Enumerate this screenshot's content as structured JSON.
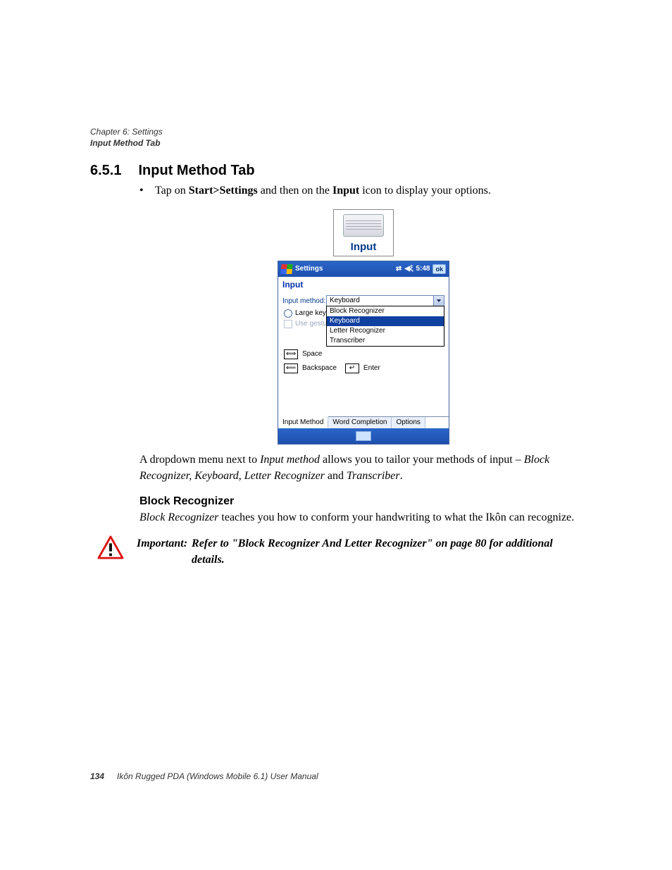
{
  "running_head": {
    "chapter": "Chapter 6:  Settings",
    "section": "Input Method Tab"
  },
  "section": {
    "number": "6.5.1",
    "title": "Input Method Tab"
  },
  "bullet": {
    "pre": "Tap on ",
    "b1": "Start>Settings",
    "mid": " and then on the ",
    "b2": "Input",
    "post": " icon to display your options."
  },
  "icon_label": "Input",
  "device": {
    "title": "Settings",
    "time": "5:48",
    "ok": "ok",
    "screen_title": "Input",
    "labels": {
      "input_method": "Input method:",
      "large_keys": "Large keys",
      "use_gestures": "Use gestures",
      "space": "Space",
      "backspace": "Backspace",
      "enter": "Enter"
    },
    "dropdown_value": "Keyboard",
    "options": [
      "Block Recognizer",
      "Keyboard",
      "Letter Recognizer",
      "Transcriber"
    ],
    "selected_option": "Keyboard",
    "tabs": [
      "Input Method",
      "Word Completion",
      "Options"
    ],
    "active_tab": "Input Method"
  },
  "para1": {
    "t1": "A dropdown menu next to ",
    "i1": "Input method",
    "t2": " allows you to tailor your methods of input – ",
    "i2": "Block Recognizer, Keyboard, Letter Recognizer",
    "t3": " and ",
    "i3": "Transcriber",
    "t4": "."
  },
  "sub_heading": "Block Recognizer",
  "para2": {
    "i1": "Block Recognizer",
    "t1": " teaches you how to conform your handwriting to what the Ikôn can recognize."
  },
  "important": {
    "lead": "Important:",
    "body": "Refer to \"Block Recognizer And Letter Recognizer\" on page 80 for additional details."
  },
  "footer": {
    "page": "134",
    "title": "Ikôn Rugged PDA (Windows Mobile 6.1) User Manual"
  }
}
